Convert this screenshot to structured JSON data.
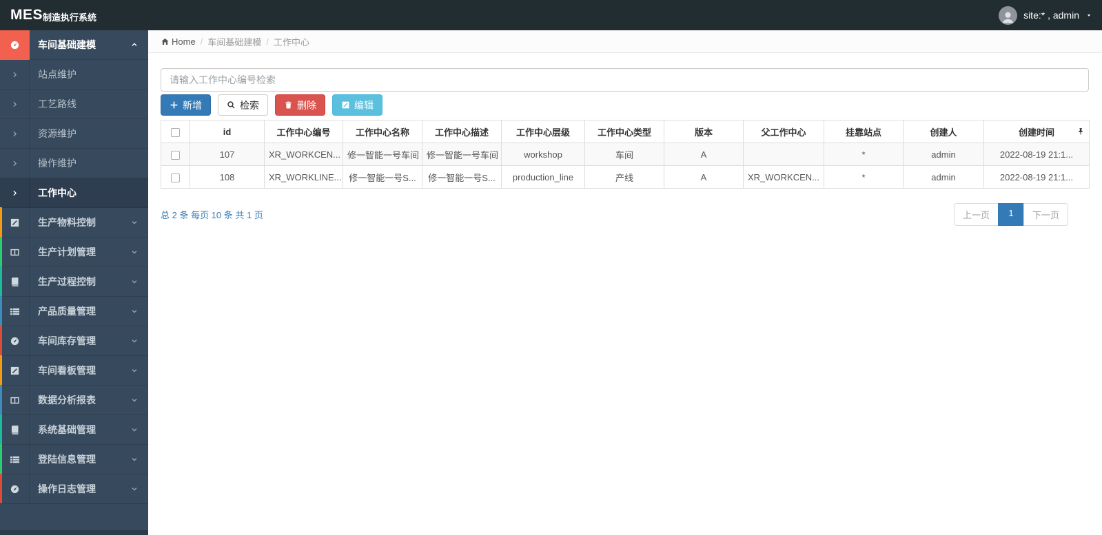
{
  "topbar": {
    "brand_bold": "MES",
    "brand_rest": "制造执行系统",
    "user_label": "site:* , admin"
  },
  "breadcrumb": {
    "home": "Home",
    "separator": "/",
    "items": [
      "车间基础建模",
      "工作中心"
    ]
  },
  "search": {
    "placeholder": "请输入工作中心编号检索",
    "value": ""
  },
  "toolbar": {
    "buttons": [
      {
        "label": "新增",
        "icon": "plus-icon",
        "style": "primary"
      },
      {
        "label": "检索",
        "icon": "search-icon",
        "style": "default"
      },
      {
        "label": "删除",
        "icon": "trash-icon",
        "style": "danger"
      },
      {
        "label": "编辑",
        "icon": "edit-icon",
        "style": "info"
      }
    ]
  },
  "table": {
    "columns": [
      "id",
      "工作中心编号",
      "工作中心名称",
      "工作中心描述",
      "工作中心层级",
      "工作中心类型",
      "版本",
      "父工作中心",
      "挂靠站点",
      "创建人",
      "创建时间"
    ],
    "rows": [
      [
        "107",
        "XR_WORKCEN...",
        "修一智能一号车间",
        "修一智能一号车间",
        "workshop",
        "车间",
        "A",
        "",
        "*",
        "admin",
        "2022-08-19 21:1..."
      ],
      [
        "108",
        "XR_WORKLINE...",
        "修一智能一号S...",
        "修一智能一号S...",
        "production_line",
        "产线",
        "A",
        "XR_WORKCEN...",
        "*",
        "admin",
        "2022-08-19 21:1..."
      ]
    ]
  },
  "pagination": {
    "summary": "总 2 条  每页 10 条  共 1 页",
    "prev": "上一页",
    "current": "1",
    "next": "下一页"
  },
  "sidebar": {
    "items": [
      {
        "label": "车间基础建模",
        "icon": "dashboard-icon",
        "type": "group",
        "active": true,
        "expanded": true,
        "stripe": ""
      },
      {
        "label": "站点维护",
        "icon": "angle-right-icon",
        "type": "sub",
        "active": false,
        "stripe": ""
      },
      {
        "label": "工艺路线",
        "icon": "angle-right-icon",
        "type": "sub",
        "active": false,
        "stripe": ""
      },
      {
        "label": "资源维护",
        "icon": "angle-right-icon",
        "type": "sub",
        "active": false,
        "stripe": ""
      },
      {
        "label": "操作维护",
        "icon": "angle-right-icon",
        "type": "sub",
        "active": false,
        "stripe": ""
      },
      {
        "label": "工作中心",
        "icon": "angle-right-icon",
        "type": "sub",
        "active": true,
        "stripe": ""
      },
      {
        "label": "生产物料控制",
        "icon": "edit-icon",
        "type": "group",
        "active": false,
        "stripe": "#f39c12"
      },
      {
        "label": "生产计划管理",
        "icon": "columns-icon",
        "type": "group",
        "active": false,
        "stripe": "#2ecc71"
      },
      {
        "label": "生产过程控制",
        "icon": "book-icon",
        "type": "group",
        "active": false,
        "stripe": "#1abc9c"
      },
      {
        "label": "产品质量管理",
        "icon": "list-icon",
        "type": "group",
        "active": false,
        "stripe": "#3c8dbc"
      },
      {
        "label": "车间库存管理",
        "icon": "dashboard-icon",
        "type": "group",
        "active": false,
        "stripe": "#dd4b39"
      },
      {
        "label": "车间看板管理",
        "icon": "edit-icon",
        "type": "group",
        "active": false,
        "stripe": "#f39c12"
      },
      {
        "label": "数据分析报表",
        "icon": "columns-icon",
        "type": "group",
        "active": false,
        "stripe": "#3c8dbc"
      },
      {
        "label": "系统基础管理",
        "icon": "book-icon",
        "type": "group",
        "active": false,
        "stripe": "#1abc9c"
      },
      {
        "label": "登陆信息管理",
        "icon": "list-icon",
        "type": "group",
        "active": false,
        "stripe": "#2ecc71"
      },
      {
        "label": "操作日志管理",
        "icon": "dashboard-icon",
        "type": "group",
        "active": false,
        "stripe": "#dd4b39"
      }
    ]
  },
  "colors": {
    "primary": "#337ab7",
    "danger": "#d9534f",
    "info": "#5bc0de",
    "active_red": "#f2604f",
    "sidebar_bg": "#37495c",
    "topbar_bg": "#222d32"
  }
}
